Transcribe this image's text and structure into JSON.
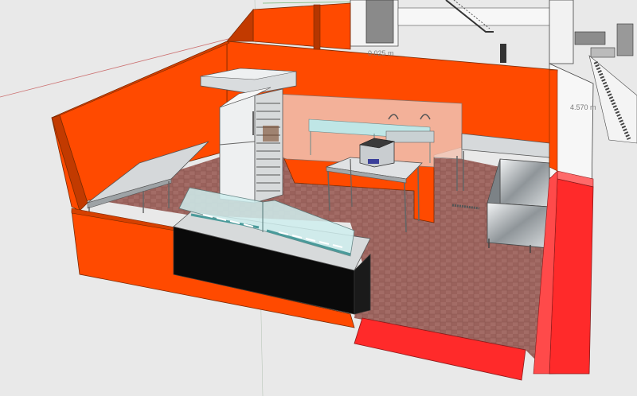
{
  "viewport": {
    "dimension_labels": [
      "0.025 m",
      "4.570 m"
    ]
  },
  "colors": {
    "background": "#e9e9e9",
    "wall_orange": "#ff4a00",
    "wall_shade": "#c23a00",
    "floor_tile": "#a06a64",
    "steel": "#cfd3d6",
    "glass": "#bfe6e6",
    "counter_black": "#0a0a0a",
    "ramp_red": "#ff2a2a",
    "axis_red": "#c04040",
    "axis_green": "#40a040"
  }
}
